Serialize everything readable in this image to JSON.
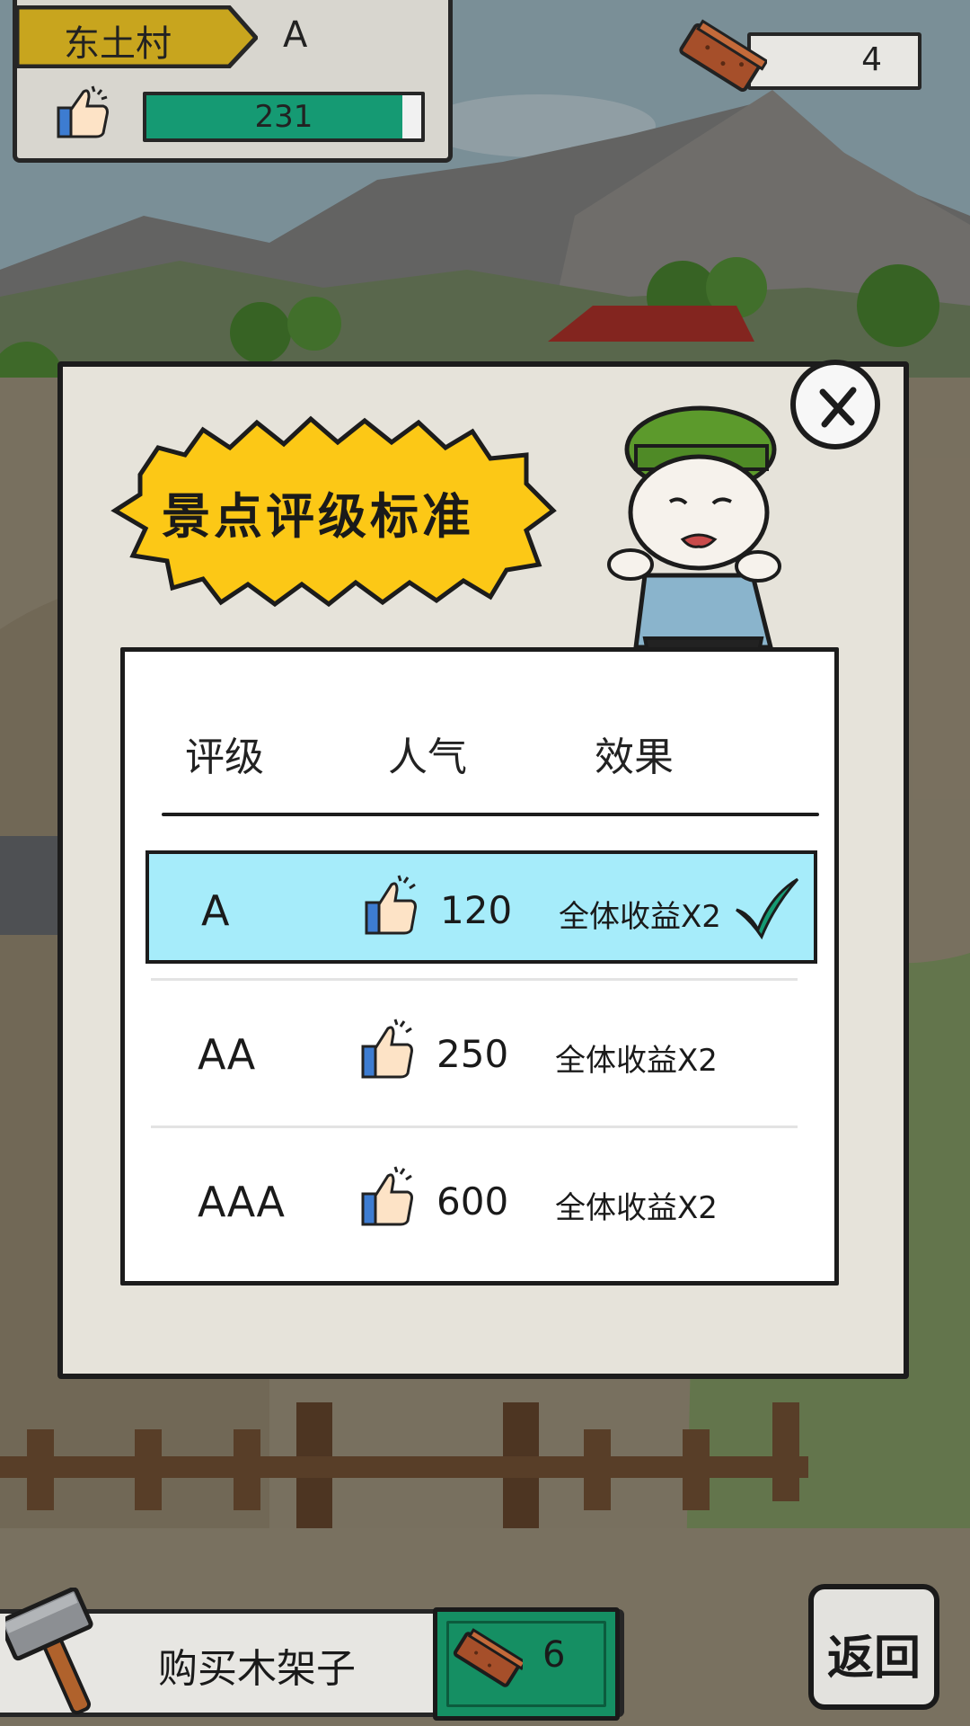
{
  "top_bar": {
    "village_name": "东土村",
    "village_grade": "A",
    "popularity": "231",
    "popularity_progress": 0.93,
    "brick_count": "4"
  },
  "dialog": {
    "title": "景点评级标准",
    "columns": [
      "评级",
      "人气",
      "效果"
    ],
    "rows": [
      {
        "grade": "A",
        "popularity": "120",
        "effect": "全体收益X2",
        "selected": true
      },
      {
        "grade": "AA",
        "popularity": "250",
        "effect": "全体收益X2",
        "selected": false
      },
      {
        "grade": "AAA",
        "popularity": "600",
        "effect": "全体收益X2",
        "selected": false
      }
    ]
  },
  "bottom_bar": {
    "buy_label": "购买木架子",
    "cost": "6",
    "back_label": "返回"
  },
  "colors": {
    "popularity_fill": "#159a73",
    "selected_row": "#a6ecfa",
    "title_burst": "#fcc816",
    "cost_box": "#158f63",
    "check": "#159a73"
  }
}
